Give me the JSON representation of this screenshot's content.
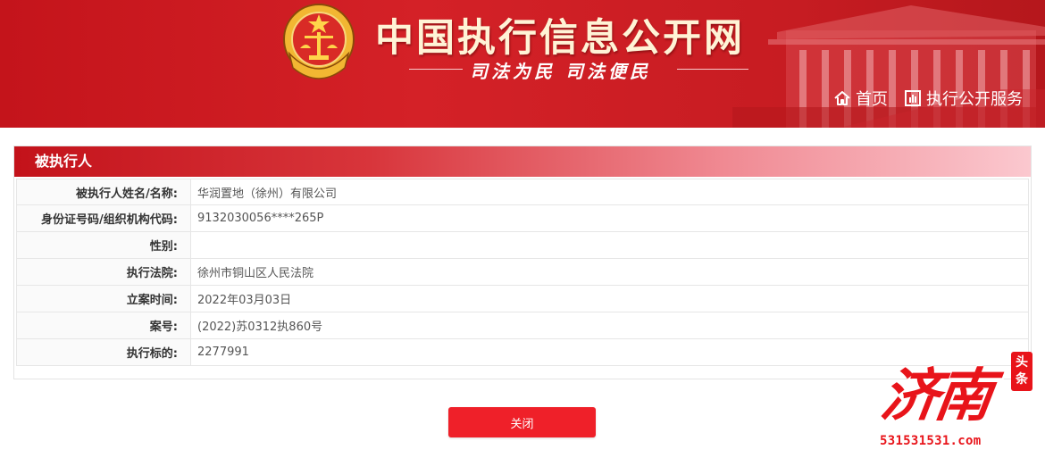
{
  "header": {
    "site_title": "中国执行信息公开网",
    "slogan": "司法为民   司法便民",
    "nav": {
      "home": "首页",
      "service": "执行公开服务"
    }
  },
  "panel": {
    "title": "被执行人",
    "rows": [
      {
        "label": "被执行人姓名/名称:",
        "value": "华润置地（徐州）有限公司"
      },
      {
        "label": "身份证号码/组织机构代码:",
        "value": "9132030056****265P"
      },
      {
        "label": "性别:",
        "value": ""
      },
      {
        "label": "执行法院:",
        "value": "徐州市铜山区人民法院"
      },
      {
        "label": "立案时间:",
        "value": "2022年03月03日"
      },
      {
        "label": "案号:",
        "value": "(2022)苏0312执860号"
      },
      {
        "label": "执行标的:",
        "value": "2277991"
      }
    ]
  },
  "close_button": "关闭",
  "watermark": {
    "text": "济南",
    "seal_top": "头",
    "seal_bottom": "条",
    "url": "531531531.com"
  },
  "colors": {
    "banner_red": "#c4141b",
    "title_gold": "#fff3d6",
    "button_red": "#ef2029",
    "watermark_red": "#e8141a"
  },
  "icons": {
    "home": "home-icon",
    "service": "bar-chart-icon",
    "emblem": "national-court-emblem"
  }
}
